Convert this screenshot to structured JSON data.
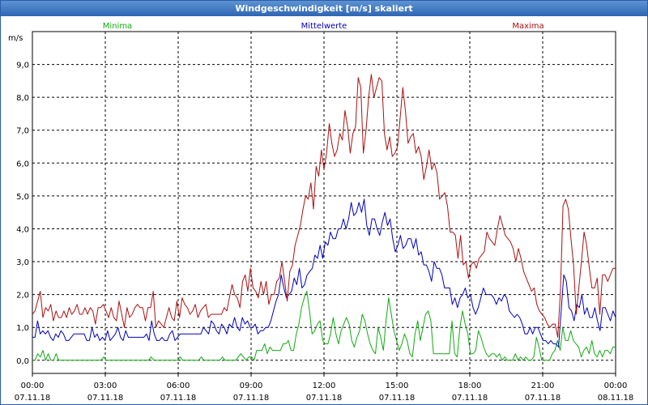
{
  "window": {
    "title": "Windgeschwindigkeit [m/s] skaliert"
  },
  "chart_data": {
    "type": "line",
    "title": "Windgeschwindigkeit [m/s] skaliert",
    "ylabel": "m/s",
    "ylim": [
      -0.4,
      10.0
    ],
    "xlim_hours": [
      0,
      24
    ],
    "grid": true,
    "legend_placement": "top",
    "y_ticks": [
      "0,0",
      "1,0",
      "2,0",
      "3,0",
      "4,0",
      "5,0",
      "6,0",
      "7,0",
      "8,0",
      "9,0"
    ],
    "x_ticks": [
      {
        "time": "00:00",
        "date": "07.11.18"
      },
      {
        "time": "03:00",
        "date": "07.11.18"
      },
      {
        "time": "06:00",
        "date": "07.11.18"
      },
      {
        "time": "09:00",
        "date": "07.11.18"
      },
      {
        "time": "12:00",
        "date": "07.11.18"
      },
      {
        "time": "15:00",
        "date": "07.11.18"
      },
      {
        "time": "18:00",
        "date": "07.11.18"
      },
      {
        "time": "21:00",
        "date": "07.11.18"
      },
      {
        "time": "00:00",
        "date": "08.11.18"
      }
    ],
    "series": [
      {
        "name": "Minima",
        "color": "#11aa11",
        "values": [
          0.0,
          0.0,
          0.2,
          0.1,
          0.3,
          0.0,
          0.2,
          0.0,
          0.0,
          0.2,
          0.0,
          0.0,
          0.0,
          0.0,
          0.0,
          0.0,
          0.0,
          0.0,
          0.0,
          0.0,
          0.0,
          0.0,
          0.0,
          0.0,
          0.0,
          0.0,
          0.0,
          0.1,
          0.0,
          0.0,
          0.0,
          0.0,
          0.0,
          0.0,
          0.0,
          0.0,
          0.0,
          0.0,
          0.0,
          0.0,
          0.0,
          0.0,
          0.0,
          0.0,
          0.0,
          0.1,
          0.0,
          0.0,
          0.0,
          0.0,
          0.0,
          0.0,
          0.0,
          0.0,
          0.0,
          0.0,
          0.1,
          0.0,
          0.0,
          0.0,
          0.0,
          0.0,
          0.0,
          0.0,
          0.1,
          0.0,
          0.0,
          0.0,
          0.0,
          0.0,
          0.0,
          0.0,
          0.1,
          0.0,
          0.0,
          0.0,
          0.0,
          0.0,
          0.1,
          0.2,
          0.1,
          0.0,
          0.1,
          0.1,
          0.0,
          0.3,
          0.3,
          0.3,
          0.5,
          0.2,
          0.4,
          0.3,
          0.3,
          0.3,
          0.3,
          0.5,
          0.5,
          0.6,
          0.3,
          0.3,
          0.8,
          1.1,
          1.6,
          1.9,
          2.1,
          1.5,
          0.8,
          0.9,
          1.1,
          1.2,
          0.6,
          0.5,
          0.5,
          0.8,
          1.3,
          0.8,
          0.5,
          0.9,
          1.1,
          1.3,
          1.1,
          0.6,
          0.4,
          0.7,
          0.9,
          1.4,
          1.2,
          0.8,
          0.5,
          0.3,
          0.2,
          1.0,
          0.7,
          0.3,
          1.2,
          1.9,
          1.4,
          0.9,
          0.6,
          0.3,
          0.5,
          0.8,
          0.6,
          0.2,
          0.1,
          0.8,
          1.2,
          0.6,
          1.0,
          1.4,
          1.5,
          1.2,
          0.2,
          0.2,
          0.2,
          0.2,
          0.2,
          0.2,
          0.2,
          1.2,
          0.2,
          0.1,
          1.0,
          1.5,
          1.1,
          0.8,
          0.2,
          0.2,
          0.3,
          0.9,
          0.7,
          0.4,
          0.2,
          0.1,
          0.2,
          0.2,
          0.1,
          0.2,
          0.0,
          0.1,
          0.0,
          0.0,
          0.0,
          0.2,
          0.0,
          0.1,
          0.0,
          0.1,
          0.0,
          0.0,
          0.1,
          0.7,
          0.4,
          0.0,
          0.0,
          0.0,
          0.0,
          0.2,
          0.3,
          0.6,
          0.3,
          1.0,
          0.6,
          0.6,
          0.9,
          0.6,
          0.5,
          0.4,
          0.1,
          0.3,
          0.4,
          0.2,
          0.6,
          0.2,
          0.1,
          0.3,
          0.1,
          0.3,
          0.3,
          0.2,
          0.4,
          0.4
        ]
      },
      {
        "name": "Mittelwerte",
        "color": "#0000bb",
        "values": [
          0.7,
          0.7,
          1.2,
          0.8,
          0.9,
          0.8,
          0.9,
          0.7,
          0.6,
          0.8,
          0.7,
          0.9,
          0.8,
          0.6,
          0.6,
          0.7,
          0.8,
          0.8,
          0.8,
          0.8,
          0.8,
          0.6,
          0.6,
          1.0,
          0.7,
          0.8,
          0.6,
          0.7,
          0.6,
          0.9,
          0.6,
          0.7,
          0.8,
          1.0,
          0.7,
          0.6,
          0.9,
          0.7,
          0.7,
          0.7,
          0.7,
          0.7,
          0.7,
          0.7,
          0.8,
          0.6,
          1.2,
          0.8,
          0.6,
          0.6,
          0.7,
          0.6,
          0.6,
          0.8,
          0.9,
          0.6,
          0.7,
          0.8,
          0.8,
          0.8,
          0.8,
          0.8,
          0.8,
          0.8,
          0.8,
          0.8,
          1.0,
          0.9,
          0.8,
          1.2,
          1.1,
          0.9,
          0.8,
          1.1,
          1.0,
          0.8,
          1.1,
          1.0,
          1.3,
          1.0,
          0.9,
          1.3,
          1.1,
          1.2,
          1.0,
          1.0,
          1.1,
          0.8,
          0.9,
          0.9,
          1.0,
          1.0,
          1.2,
          1.5,
          1.8,
          2.0,
          2.6,
          2.2,
          1.9,
          2.0,
          2.1,
          2.5,
          2.3,
          2.8,
          2.2,
          2.3,
          2.6,
          2.7,
          2.8,
          3.2,
          3.1,
          3.5,
          3.1,
          3.6,
          3.5,
          3.9,
          3.7,
          3.7,
          4.0,
          4.0,
          4.3,
          4.0,
          4.3,
          4.8,
          4.4,
          4.5,
          4.8,
          4.5,
          4.9,
          4.1,
          3.8,
          4.3,
          4.3,
          4.0,
          3.8,
          4.2,
          4.5,
          4.1,
          4.3,
          3.7,
          3.3,
          3.5,
          3.8,
          3.4,
          3.5,
          3.7,
          3.7,
          3.4,
          3.7,
          3.2,
          3.3,
          2.9,
          2.9,
          2.7,
          2.4,
          3.0,
          2.8,
          2.8,
          2.6,
          2.2,
          2.2,
          2.2,
          1.7,
          1.9,
          1.6,
          1.9,
          2.0,
          2.2,
          1.9,
          2.0,
          1.6,
          1.4,
          1.6,
          1.9,
          2.2,
          2.0,
          2.0,
          2.0,
          1.9,
          1.7,
          1.9,
          1.8,
          2.0,
          1.9,
          1.5,
          1.4,
          1.3,
          1.4,
          1.3,
          1.1,
          0.8,
          0.8,
          1.0,
          0.8,
          1.0,
          1.0,
          0.8,
          0.6,
          0.6,
          0.5,
          0.6,
          0.5,
          0.5,
          0.4,
          1.5,
          2.6,
          2.4,
          1.6,
          1.5,
          1.2,
          1.7,
          1.6,
          2.0,
          1.4,
          1.6,
          1.3,
          1.3,
          1.6,
          1.2,
          0.9,
          1.6,
          1.6,
          1.4,
          1.2,
          1.5,
          1.3
        ]
      },
      {
        "name": "Maxima",
        "color": "#aa1111",
        "values": [
          1.4,
          1.5,
          1.8,
          2.1,
          1.3,
          1.6,
          1.5,
          1.7,
          1.2,
          1.5,
          1.3,
          1.3,
          1.5,
          1.3,
          1.6,
          1.4,
          1.5,
          1.7,
          1.4,
          1.4,
          1.6,
          1.4,
          1.6,
          1.5,
          1.1,
          1.6,
          1.6,
          1.7,
          1.5,
          1.3,
          1.6,
          1.3,
          1.2,
          1.8,
          1.4,
          1.0,
          1.6,
          1.3,
          1.4,
          1.6,
          1.7,
          1.6,
          1.6,
          1.2,
          1.6,
          1.6,
          2.1,
          1.0,
          1.2,
          1.1,
          1.0,
          1.3,
          1.6,
          1.3,
          1.2,
          1.8,
          1.3,
          1.9,
          1.7,
          1.6,
          1.4,
          1.5,
          1.7,
          1.3,
          1.5,
          1.6,
          1.7,
          1.3,
          1.4,
          1.4,
          1.4,
          1.4,
          1.4,
          1.6,
          1.5,
          1.9,
          2.3,
          2.0,
          1.9,
          1.6,
          2.4,
          2.6,
          2.1,
          2.8,
          2.2,
          2.1,
          1.9,
          2.4,
          2.0,
          2.4,
          1.7,
          2.0,
          2.0,
          2.4,
          2.5,
          3.0,
          2.4,
          1.8,
          2.7,
          2.9,
          3.5,
          3.8,
          4.1,
          4.6,
          5.0,
          4.9,
          5.4,
          4.6,
          5.9,
          5.6,
          6.4,
          5.8,
          6.3,
          7.2,
          6.6,
          6.2,
          6.4,
          6.9,
          6.7,
          7.6,
          7.1,
          6.3,
          6.9,
          7.1,
          8.6,
          8.3,
          6.3,
          7.0,
          8.0,
          8.7,
          8.0,
          8.3,
          8.6,
          8.5,
          6.9,
          6.4,
          6.8,
          6.2,
          6.3,
          6.5,
          7.4,
          8.3,
          7.6,
          6.6,
          6.8,
          6.9,
          6.3,
          6.5,
          6.2,
          5.5,
          5.9,
          6.4,
          5.8,
          6.0,
          5.7,
          4.9,
          5.0,
          5.1,
          4.7,
          3.9,
          3.9,
          3.8,
          3.1,
          3.8,
          2.9,
          3.0,
          2.5,
          2.9,
          3.0,
          2.8,
          3.1,
          3.2,
          3.3,
          3.9,
          3.7,
          3.6,
          3.5,
          4.0,
          4.4,
          4.1,
          3.8,
          3.7,
          3.6,
          3.4,
          3.0,
          3.4,
          3.1,
          2.7,
          2.5,
          2.3,
          2.1,
          2.2,
          1.7,
          1.5,
          1.4,
          1.3,
          1.1,
          1.0,
          1.1,
          1.1,
          0.7,
          2.1,
          4.7,
          4.9,
          4.6,
          3.7,
          2.9,
          1.4,
          2.2,
          3.0,
          3.9,
          3.5,
          2.8,
          2.2,
          2.2,
          2.5,
          1.4,
          2.6,
          2.6,
          2.4,
          2.6,
          2.8,
          2.8
        ]
      }
    ]
  }
}
